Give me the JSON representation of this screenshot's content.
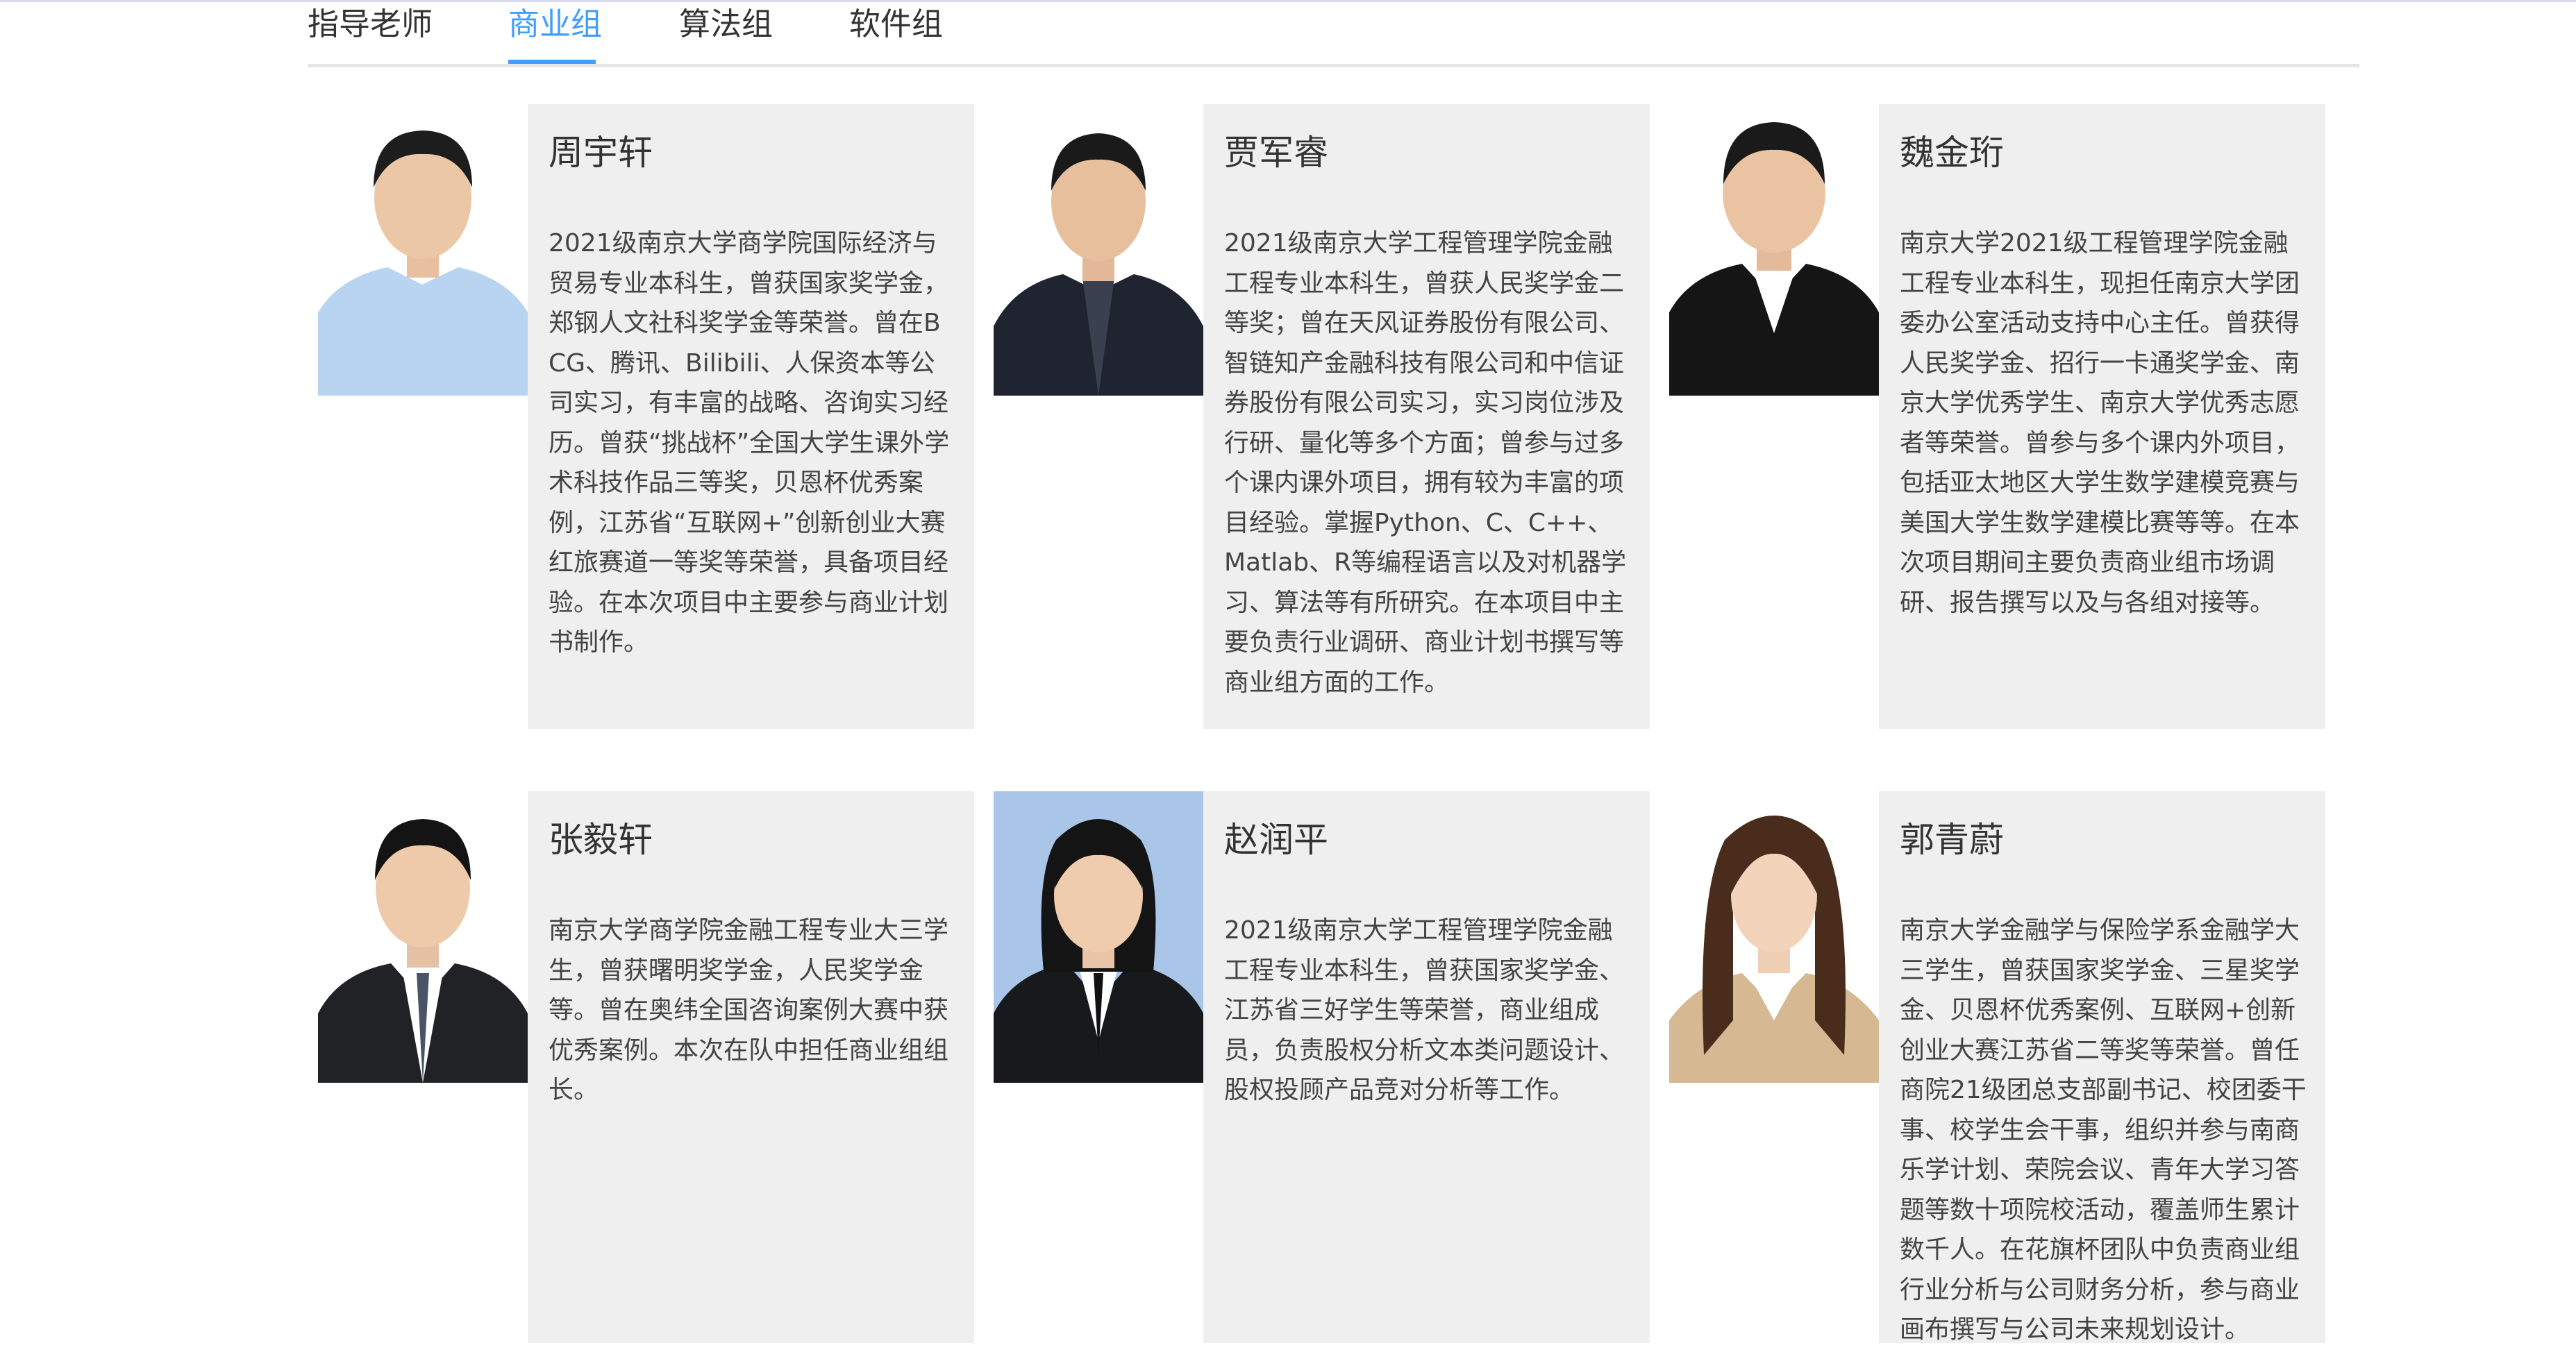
{
  "tabs": [
    {
      "label": "指导老师"
    },
    {
      "label": "商业组"
    },
    {
      "label": "算法组"
    },
    {
      "label": "软件组"
    }
  ],
  "active_tab": "商业组",
  "members": [
    {
      "name": "周宇轩",
      "bio": "2021级南京大学商学院国际经济与贸易专业本科生，曾获国家奖学金，郑钢人文社科奖学金等荣誉。曾在BCG、腾讯、Bilibili、人保资本等公司实习，有丰富的战略、咨询实习经历。曾获“挑战杯”全国大学生课外学术科技作品三等奖，贝恩杯优秀案例，江苏省“互联网+”创新创业大赛红旅赛道一等奖等荣誉，具备项目经验。在本次项目中主要参与商业计划书制作。",
      "photo_icon": "portrait-photo"
    },
    {
      "name": "贾军睿",
      "bio": "2021级南京大学工程管理学院金融工程专业本科生，曾获人民奖学金二等奖；曾在天风证券股份有限公司、智链知产金融科技有限公司和中信证券股份有限公司实习，实习岗位涉及行研、量化等多个方面；曾参与过多个课内课外项目，拥有较为丰富的项目经验。掌握Python、C、C++、Matlab、R等编程语言以及对机器学习、算法等有所研究。在本项目中主要负责行业调研、商业计划书撰写等商业组方面的工作。",
      "photo_icon": "portrait-photo"
    },
    {
      "name": "魏金珩",
      "bio": "南京大学2021级工程管理学院金融工程专业本科生，现担任南京大学团委办公室活动支持中心主任。曾获得人民奖学金、招行一卡通奖学金、南京大学优秀学生、南京大学优秀志愿者等荣誉。曾参与多个课内外项目，包括亚太地区大学生数学建模竞赛与美国大学生数学建模比赛等等。在本次项目期间主要负责商业组市场调研、报告撰写以及与各组对接等。",
      "photo_icon": "portrait-photo"
    },
    {
      "name": "张毅轩",
      "bio": "南京大学商学院金融工程专业大三学生，曾获曙明奖学金，人民奖学金等。曾在奥纬全国咨询案例大赛中获优秀案例。本次在队中担任商业组组长。",
      "photo_icon": "portrait-photo"
    },
    {
      "name": "赵润平",
      "bio": "2021级南京大学工程管理学院金融工程专业本科生，曾获国家奖学金、江苏省三好学生等荣誉，商业组成员，负责股权分析文本类问题设计、股权投顾产品竞对分析等工作。",
      "photo_icon": "portrait-photo"
    },
    {
      "name": "郭青蔚",
      "bio": "南京大学金融学与保险学系金融学大三学生，曾获国家奖学金、三星奖学金、贝恩杯优秀案例、互联网+创新创业大赛江苏省二等奖等荣誉。曾任商院21级团总支部副书记、校团委干事、校学生会干事，组织并参与南商乐学计划、荣院会议、青年大学习答题等数十项院校活动，覆盖师生累计数千人。在花旗杯团队中负责商业组行业分析与公司财务分析，参与商业画布撰写与公司未来规划设计。",
      "photo_icon": "portrait-photo"
    }
  ],
  "colors": {
    "accent": "#409eff",
    "card_bg": "#efefef",
    "divider": "#e6e6e6"
  }
}
